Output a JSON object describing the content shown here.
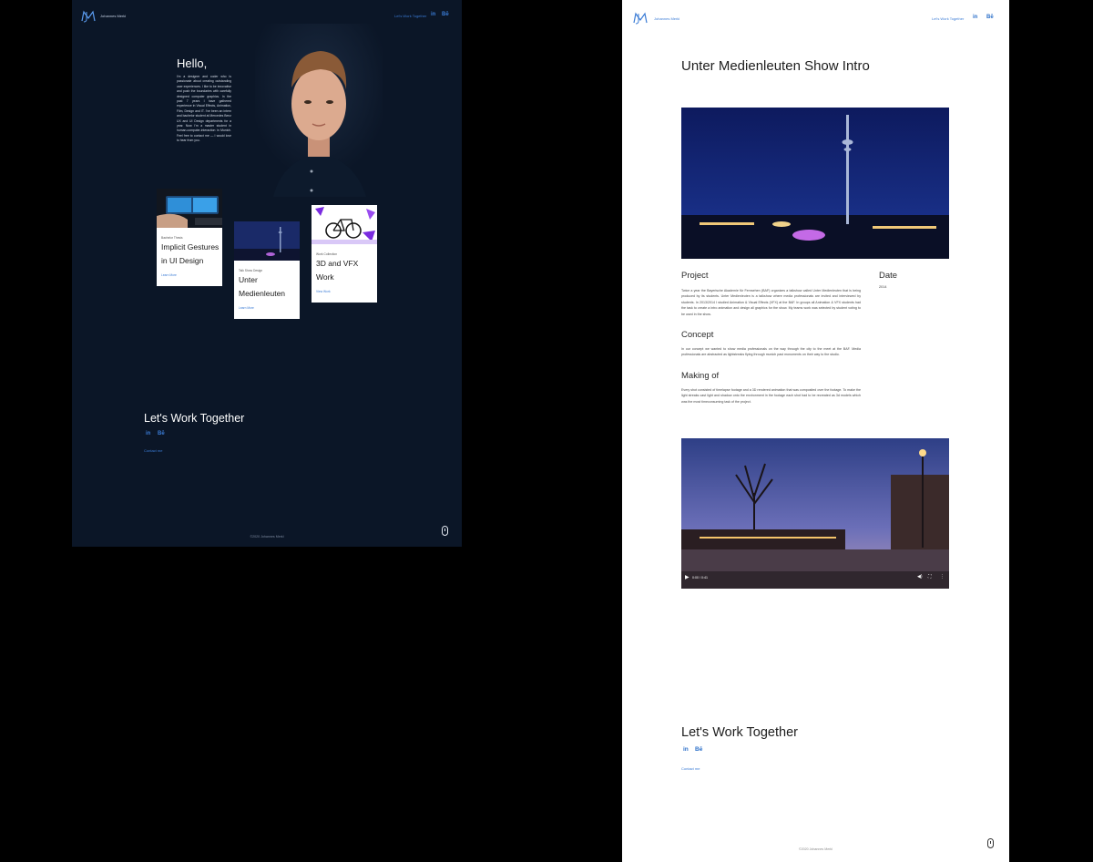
{
  "brand": {
    "name": "Johannes Merkl",
    "accent": "#3a7bd5"
  },
  "nav": {
    "cta_label": "Let's Work Together",
    "linkedin_label": "in",
    "behance_label": "Bē"
  },
  "home": {
    "greeting": "Hello,",
    "intro": "I'm a designer and coder who is passionate about creating outstanding user experiences. I like to be innovative and push the boundaries with carefully designed computer graphics. In the past 7 years I have gathered experience in Visual Effects, Animation, Film, Design and IT. I've been an intern and bachelor student at Mercedes Benz UX and UI Design departments for a year. Now I'm a master student in human-computer-interaction in Munich. Feel free to contact me — I would love to hear from you.",
    "cards": [
      {
        "category": "Bachelor Thesis",
        "title": "Implicit Gestures in UI Design",
        "link": "Learn More"
      },
      {
        "category": "Talk Show Design",
        "title": "Unter Medienleuten",
        "link": "Learn More"
      },
      {
        "category": "Work Collection",
        "title": "3D and VFX Work",
        "link": "View Work"
      }
    ],
    "cta": {
      "title": "Let's Work Together",
      "contact": "Contact me"
    },
    "footer": "©2020 Johannes Merkl"
  },
  "project": {
    "title": "Unter Medienleuten Show Intro",
    "sections": [
      {
        "heading": "Project",
        "text": "Twice a year the Bayerische Akademie für Fernsehen (BAF) organizes a talkshow called Unter Medienleuten that is being produced by its students. Unter Medienleuten is a talkshow where media professionals are invited and interviewed by students. In 2013/2014 I studied Animation & Visual Effects (VFX) at the BAF. In groups all Animation & VFX students had the task to create a intro animation and design all graphics for the show. My teams work was selected by student voting to be used in the show."
      },
      {
        "heading": "Concept",
        "text": "In our concept we wanted to show media professionals on the way through the city to the meet at the BAF. Media professionals are abstracted as lightstreaks flying through munich past monuments on their way to the studio."
      },
      {
        "heading": "Making of",
        "text": "Every shot consisted of timelapse footage and a 3D rendered animation that was composited over the footage. To make the light streaks cast light and shadow onto the environment in the footage each shot had to be recreated as 3d models which was the most timeconsuming task of the project."
      }
    ],
    "date_label": "Date",
    "date_value": "2014",
    "video_time": "0:00 / 0:41",
    "cta": {
      "title": "Let's Work Together",
      "contact": "Contact me"
    },
    "footer": "©2020 Johannes Merkl"
  }
}
